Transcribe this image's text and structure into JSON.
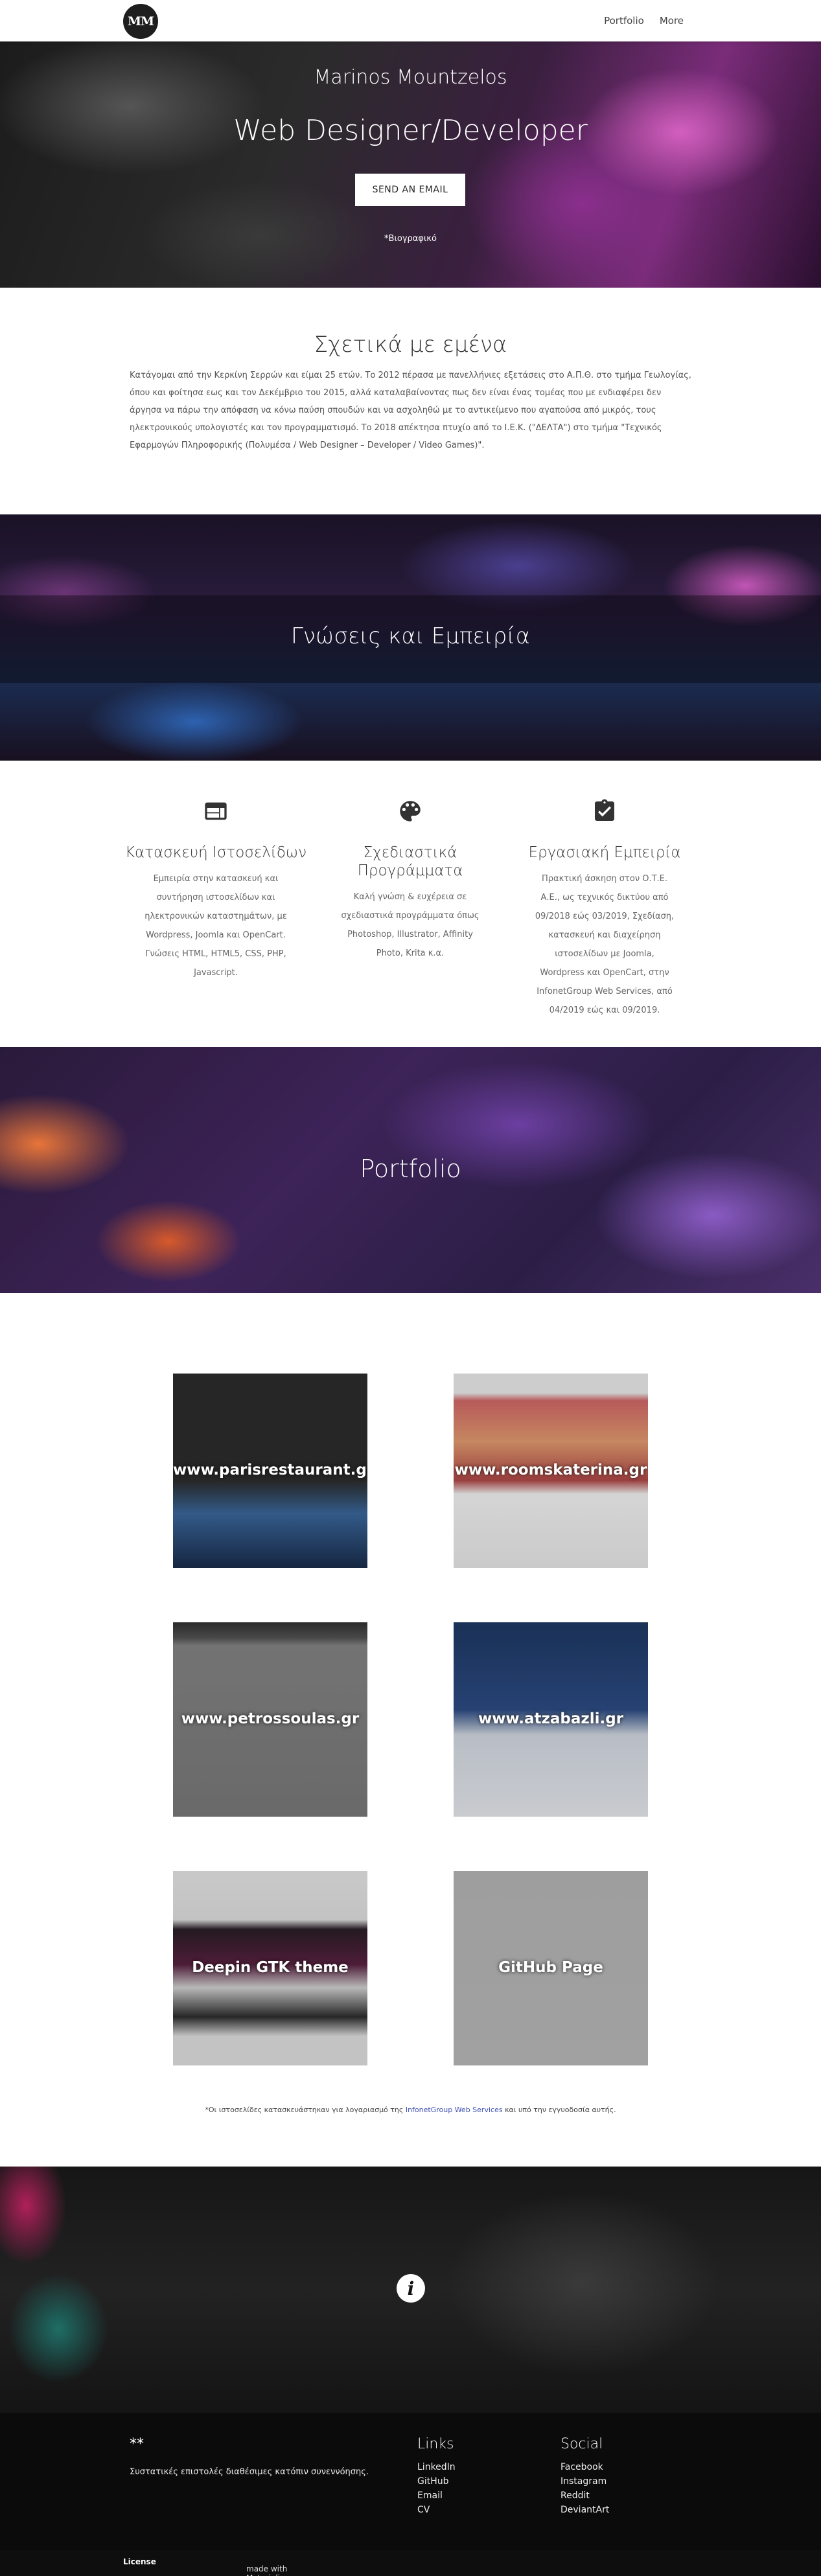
{
  "nav": {
    "logo_text": "MM",
    "links": [
      {
        "label": "Portfolio"
      },
      {
        "label": "More"
      }
    ]
  },
  "hero": {
    "name": "Marinos Mountzelos",
    "title": "Web Designer/Developer",
    "button": "SEND AN EMAIL",
    "bio_link": "*Βιογραφικό"
  },
  "about": {
    "title": "Σχετικά με εμένα",
    "text": "Κατάγομαι από την Κερκίνη Σερρών και είμαι 25 ετών. Το 2012 πέρασα με πανελλήνιες εξετάσεις στο Α.Π.Θ. στο τμήμα Γεωλογίας, όπου και φοίτησα εως και τον Δεκέμβριο του 2015, αλλά καταλαβαίνοντας πως δεν είναι ένας τομέας που με ενδιαφέρει δεν άργησα να πάρω την απόφαση να κόνω παύση σπουδών και να ασχοληθώ με το αντικείμενο που αγαπούσα από μικρός, τους ηλεκτρονικούς υπολογιστές και τον προγραμματισμό. Το 2018 απέκτησα πτυχίο από το Ι.Ε.Κ. (\"ΔΕΛΤΑ\") στο τμήμα \"Τεχνικός Εφαρμογών Πληροφορικής (Πολυμέσα / Web Designer – Developer / Video Games)\"."
  },
  "skills_banner": {
    "title": "Γνώσεις και Εμπειρία"
  },
  "skills": [
    {
      "icon": "web-icon",
      "title": "Κατασκευή Ιστοσελίδων",
      "text": "Εμπειρία στην κατασκευή και συντήρηση ιστοσελίδων και ηλεκτρονικών καταστημάτων, με Wordpress, Joomla και OpenCart. Γνώσεις HTML, HTML5, CSS, PHP, Javascript."
    },
    {
      "icon": "palette-icon",
      "title": "Σχεδιαστικά Προγράμματα",
      "text": "Καλή γνώση & ευχέρεια σε σχεδιαστικά προγράμματα όπως Photoshop, Illustrator, Affinity Photo, Krita κ.α."
    },
    {
      "icon": "assignment-check-icon",
      "title": "Εργασιακή Εμπειρία",
      "text": "Πρακτική άσκηση στον Ο.Τ.Ε. Α.Ε., ως τεχνικός δικτύου από 09/2018 εώς 03/2019, Σχεδίαση, κατασκευή και διαχείρηση ιστοσελίδων με Joomla, Wordpress και OpenCart, στην InfonetGroup Web Services, από 04/2019 εώς και 09/2019."
    }
  ],
  "portfolio_banner": {
    "title": "Portfolio"
  },
  "portfolio": [
    {
      "caption": "www.parisrestaurant.gr"
    },
    {
      "caption": "www.roomskaterina.gr"
    },
    {
      "caption": "www.petrossoulas.gr"
    },
    {
      "caption": "www.atzabazli.gr"
    },
    {
      "caption": "Deepin GTK theme"
    },
    {
      "caption": "GitHub Page"
    }
  ],
  "footnote": {
    "before": "*Οι ιστοσελίδες κατασκευάστηκαν για λογαριασμό της ",
    "link": "InfonetGroup Web Services",
    "after": " και υπό την εγγυοδοσία αυτής."
  },
  "footer": {
    "stars": "**",
    "message": "Συστατικές επιστολές διαθέσιμες κατόπιν συνεννόησης.",
    "links_title": "Links",
    "links": [
      "LinkedIn",
      "GitHub",
      "Email",
      "CV"
    ],
    "social_title": "Social",
    "social": [
      "Facebook",
      "Instagram",
      "Reddit",
      "DeviantArt"
    ],
    "credit_prefix": "made with Materialize. ",
    "credit_link": "License"
  }
}
